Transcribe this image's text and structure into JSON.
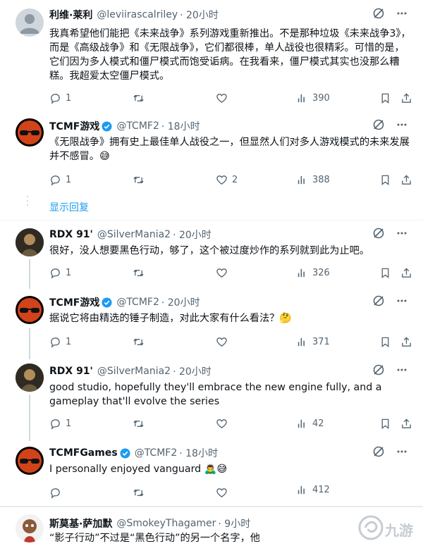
{
  "tweets": [
    {
      "name": "利维·莱利",
      "handle": "@leviirascalriley",
      "time": "· 20小时",
      "body": "我真希望他们能把《未来战争》系列游戏重新推出。不是那种垃圾《未来战争3》，而是《高级战争》和《无限战争》，它们都很棒，单人战役也很精彩。可惜的是，它们因为多人模式和僵尸模式而饱受诟病。在我看来，僵尸模式其实也没那么糟糕。我超爱太空僵尸模式。",
      "replies": "1",
      "retweets": "",
      "likes": "",
      "views": "390"
    },
    {
      "name": "TCMF游戏",
      "handle": "@TCMF2",
      "time": "· 18小时",
      "body": "《无限战争》拥有史上最佳单人战役之一，但显然人们对多人游戏模式的未来发展并不感冒。😅",
      "replies": "1",
      "retweets": "",
      "likes": "2",
      "views": "388"
    },
    {
      "name": "RDX 91'",
      "handle": "@SilverMania2",
      "time": "· 20小时",
      "body": "很好，没人想要黑色行动，够了，这个被过度炒作的系列就到此为止吧。",
      "replies": "1",
      "retweets": "",
      "likes": "",
      "views": "326"
    },
    {
      "name": "TCMF游戏",
      "handle": "@TCMF2",
      "time": "· 20小时",
      "body": "据说它将由精选的锤子制造，对此大家有什么看法？🤔",
      "replies": "1",
      "retweets": "",
      "likes": "",
      "views": "371"
    },
    {
      "name": "RDX 91'",
      "handle": "@SilverMania2",
      "time": "· 20小时",
      "body": "good studio, hopefully they'll embrace the new engine fully, and a gameplay that'll evolve the series",
      "replies": "1",
      "retweets": "",
      "likes": "",
      "views": "42"
    },
    {
      "name": "TCMFGames",
      "handle": "@TCMF2",
      "time": "· 18小时",
      "body": "I personally enjoyed vanguard 🙇‍♂️😅",
      "replies": "",
      "retweets": "",
      "likes": "",
      "views": "412"
    },
    {
      "name": "斯莫基·萨加默",
      "handle": "@SmokeyThagamer",
      "time": "· 9小时",
      "body": "“影子行动”不过是“黑色行动”的另一个名字，他",
      "replies": "",
      "retweets": "",
      "likes": "",
      "views": ""
    }
  ],
  "show_replies": "显示回复",
  "watermark": "九游",
  "colors": {
    "accent": "#1d9bf0",
    "muted": "#536471",
    "divider": "#eff3f4"
  }
}
